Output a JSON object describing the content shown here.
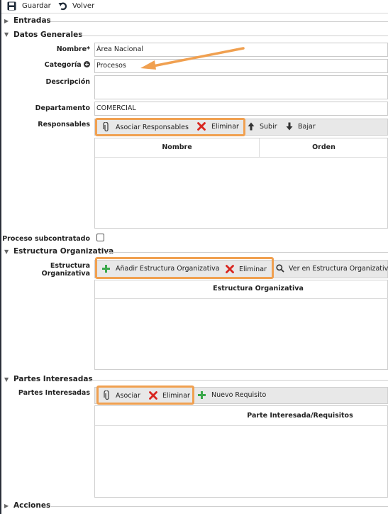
{
  "toolbar": {
    "save_label": "Guardar",
    "back_label": "Volver"
  },
  "sections": {
    "entradas": "Entradas",
    "datos_generales": "Datos Generales",
    "estructura": "Estructura Organizativa",
    "partes": "Partes Interesadas",
    "acciones": "Acciones"
  },
  "form": {
    "nombre_label": "Nombre*",
    "nombre_value": "Área Nacional",
    "categoria_label": "Categoría",
    "categoria_value": "Procesos",
    "descripcion_label": "Descripción",
    "descripcion_value": "",
    "departamento_label": "Departamento",
    "departamento_value": "COMERCIAL",
    "responsables_label": "Responsables",
    "subcontratado_label": "Proceso subcontratado",
    "estructura_label": "Estructura Organizativa",
    "partes_label": "Partes Interesadas"
  },
  "responsables": {
    "asociar": "Asociar Responsables",
    "eliminar": "Eliminar",
    "subir": "Subir",
    "bajar": "Bajar",
    "columns": [
      "Nombre",
      "Orden"
    ]
  },
  "estructura": {
    "anadir": "Añadir Estructura Organizativa",
    "eliminar": "Eliminar",
    "ver": "Ver en Estructura Organizativa",
    "column": "Estructura Organizativa"
  },
  "partes": {
    "asociar": "Asociar",
    "eliminar": "Eliminar",
    "nuevo": "Nuevo Requisito",
    "column": "Parte Interesada/Requisitos"
  },
  "colors": {
    "highlight": "#f0a050",
    "arrow": "#f0a050",
    "delete_red": "#d8251f",
    "add_green": "#3aa84a"
  }
}
